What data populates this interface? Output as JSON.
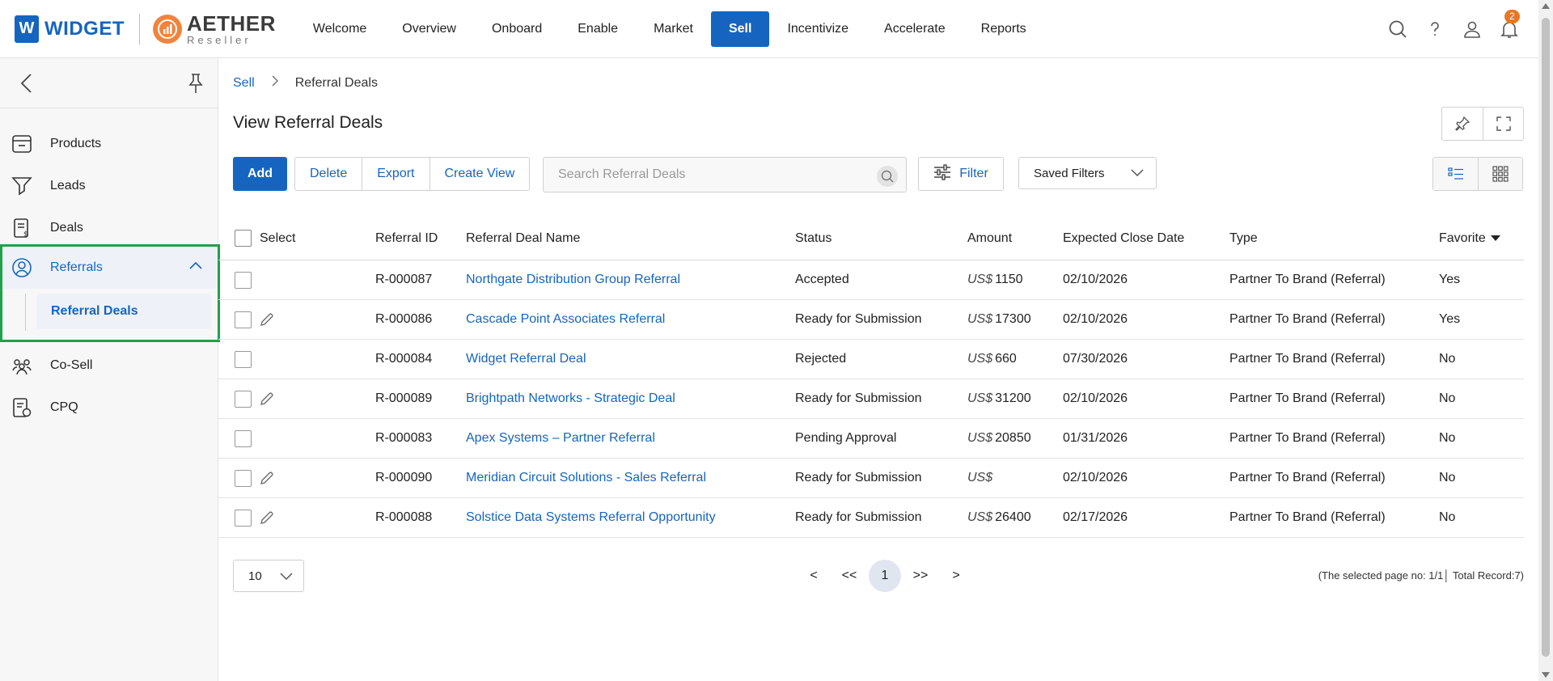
{
  "brand": {
    "badge": "W",
    "name": "WIDGET",
    "partner_name": "AETHER",
    "partner_sub": "Reseller"
  },
  "nav": {
    "items": [
      {
        "label": "Welcome",
        "active": false
      },
      {
        "label": "Overview",
        "active": false
      },
      {
        "label": "Onboard",
        "active": false
      },
      {
        "label": "Enable",
        "active": false
      },
      {
        "label": "Market",
        "active": false
      },
      {
        "label": "Sell",
        "active": true
      },
      {
        "label": "Incentivize",
        "active": false
      },
      {
        "label": "Accelerate",
        "active": false
      },
      {
        "label": "Reports",
        "active": false
      }
    ],
    "notification_count": "2"
  },
  "sidebar": {
    "items": [
      {
        "label": "Products",
        "icon": "box-icon"
      },
      {
        "label": "Leads",
        "icon": "funnel-icon"
      },
      {
        "label": "Deals",
        "icon": "invoice-icon"
      }
    ],
    "group": {
      "label": "Referrals",
      "icon": "user-circle-icon",
      "sub_item": "Referral Deals"
    },
    "items_after": [
      {
        "label": "Co-Sell",
        "icon": "team-icon"
      },
      {
        "label": "CPQ",
        "icon": "quote-icon"
      }
    ]
  },
  "breadcrumb": {
    "parent": "Sell",
    "current": "Referral Deals"
  },
  "page": {
    "title": "View Referral Deals"
  },
  "toolbar": {
    "add": "Add",
    "delete": "Delete",
    "export": "Export",
    "create_view": "Create View",
    "search_placeholder": "Search Referral Deals",
    "filter": "Filter",
    "saved_filters": "Saved Filters"
  },
  "table": {
    "headers": {
      "select": "Select",
      "id": "Referral ID",
      "name": "Referral Deal Name",
      "status": "Status",
      "amount": "Amount",
      "date": "Expected Close Date",
      "type": "Type",
      "favorite": "Favorite"
    },
    "currency": "US$",
    "rows": [
      {
        "id": "R-000087",
        "name": "Northgate Distribution Group Referral",
        "status": "Accepted",
        "amount": "1150",
        "date": "02/10/2026",
        "type": "Partner To Brand (Referral)",
        "favorite": "Yes",
        "editable": false
      },
      {
        "id": "R-000086",
        "name": "Cascade Point Associates Referral",
        "status": "Ready for Submission",
        "amount": "17300",
        "date": "02/10/2026",
        "type": "Partner To Brand (Referral)",
        "favorite": "Yes",
        "editable": true
      },
      {
        "id": "R-000084",
        "name": "Widget Referral Deal",
        "status": "Rejected",
        "amount": "660",
        "date": "07/30/2026",
        "type": "Partner To Brand (Referral)",
        "favorite": "No",
        "editable": false
      },
      {
        "id": "R-000089",
        "name": "Brightpath Networks - Strategic Deal",
        "status": "Ready for Submission",
        "amount": "31200",
        "date": "02/10/2026",
        "type": "Partner To Brand (Referral)",
        "favorite": "No",
        "editable": true
      },
      {
        "id": "R-000083",
        "name": "Apex Systems – Partner Referral",
        "status": "Pending Approval",
        "amount": "20850",
        "date": "01/31/2026",
        "type": "Partner To Brand (Referral)",
        "favorite": "No",
        "editable": false
      },
      {
        "id": "R-000090",
        "name": "Meridian Circuit Solutions - Sales Referral",
        "status": "Ready for Submission",
        "amount": "",
        "date": "02/10/2026",
        "type": "Partner To Brand (Referral)",
        "favorite": "No",
        "editable": true
      },
      {
        "id": "R-000088",
        "name": "Solstice Data Systems Referral Opportunity",
        "status": "Ready for Submission",
        "amount": "26400",
        "date": "02/17/2026",
        "type": "Partner To Brand (Referral)",
        "favorite": "No",
        "editable": true
      }
    ]
  },
  "pager": {
    "page_size": "10",
    "prev": "<",
    "first": "<<",
    "current": "1",
    "last": ">>",
    "next": ">",
    "info": "(The selected page no: 1/1│ Total Record:7)"
  },
  "colors": {
    "accent": "#1565c0",
    "highlight_border": "#22a04a",
    "badge": "#e87722"
  }
}
